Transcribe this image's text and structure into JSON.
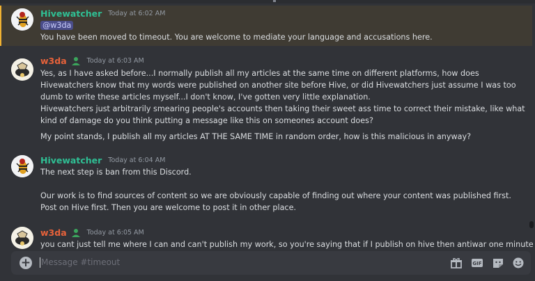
{
  "messages": [
    {
      "author": "Hivewatcher",
      "timestamp": "Today at 6:02 AM",
      "mention": "@w3da",
      "lines": [
        "You have been moved to timeout. You are welcome to mediate your language and accusations here."
      ]
    },
    {
      "author": "w3da",
      "timestamp": "Today at 6:03 AM",
      "lines": [
        "Yes, as I have asked before...I normally publish all my articles at the same time on different platforms, how does",
        "Hivewatchers know that my words were published on another site before Hive, or did Hivewatchers just assume I was too",
        "dumb to write these articles myself...I don't know, I've gotten very little explanation.",
        "Hivewatchers just arbitrarily smearing people's accounts then taking their sweet ass time to correct their mistake, like what",
        "kind of damage do you think putting a message like this on someones account does?",
        "My point stands, I publish all my articles AT THE SAME TIME in random order, how is this malicious in anyway?"
      ]
    },
    {
      "author": "Hivewatcher",
      "timestamp": "Today at 6:04 AM",
      "lines": [
        "The next step is ban from this Discord.",
        "Our work is to find sources of content so we are obviously capable of finding out where your content was published first.",
        "Post on Hive first. Then you are welcome to post it in other place."
      ]
    },
    {
      "author": "w3da",
      "timestamp": "Today at 6:05 AM",
      "lines": [
        "you cant just tell me where I can and can't publish my work, so you're saying that if I publish on hive then antiwar one minute"
      ]
    }
  ],
  "composer": {
    "placeholder": "Message #timeout",
    "icons": [
      "add-attachment-icon",
      "gift-icon",
      "gif-icon",
      "sticker-icon",
      "emoji-icon"
    ]
  },
  "colors": {
    "background": "#313338",
    "hivewatcher_name": "#2fbf94",
    "w3da_name": "#e8623a",
    "highlight_bg": "#3f3b33",
    "highlight_bar": "#f0b232",
    "mention_bg": "#4a4d8a",
    "badge": "#3ba55c"
  }
}
